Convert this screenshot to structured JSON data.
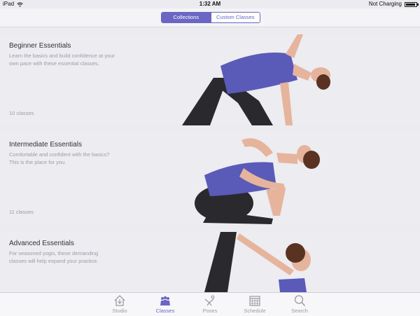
{
  "status_bar": {
    "device": "iPad",
    "time": "1:32 AM",
    "battery_text": "Not Charging",
    "battery_level": 0.95
  },
  "segmented_control": {
    "options": [
      "Collections",
      "Custom Classes"
    ],
    "selected": "Collections"
  },
  "collections": [
    {
      "title": "Beginner Essentials",
      "description": "Learn the basics and build confidence at your own pace with these essential classes.",
      "count": "10 classes"
    },
    {
      "title": "Intermediate Essentials",
      "description": "Comfortable and confident with the basics? This is the place for you.",
      "count": "11 classes"
    },
    {
      "title": "Advanced Essentials",
      "description": "For seasoned yogis, these demanding classes will help expand your practice.",
      "count": ""
    }
  ],
  "tab_bar": {
    "tabs": [
      {
        "label": "Studio",
        "icon": "house-icon"
      },
      {
        "label": "Classes",
        "icon": "group-icon"
      },
      {
        "label": "Poses",
        "icon": "pose-icon"
      },
      {
        "label": "Schedule",
        "icon": "calendar-icon"
      },
      {
        "label": "Search",
        "icon": "magnifier-icon"
      }
    ],
    "active": "Classes"
  },
  "colors": {
    "accent": "#6a66c2",
    "shirt": "#5a5ab8",
    "pants": "#2a2a2e",
    "skin": "#e6b49c",
    "hair": "#5a3222",
    "card_bg": "#ececf1"
  }
}
